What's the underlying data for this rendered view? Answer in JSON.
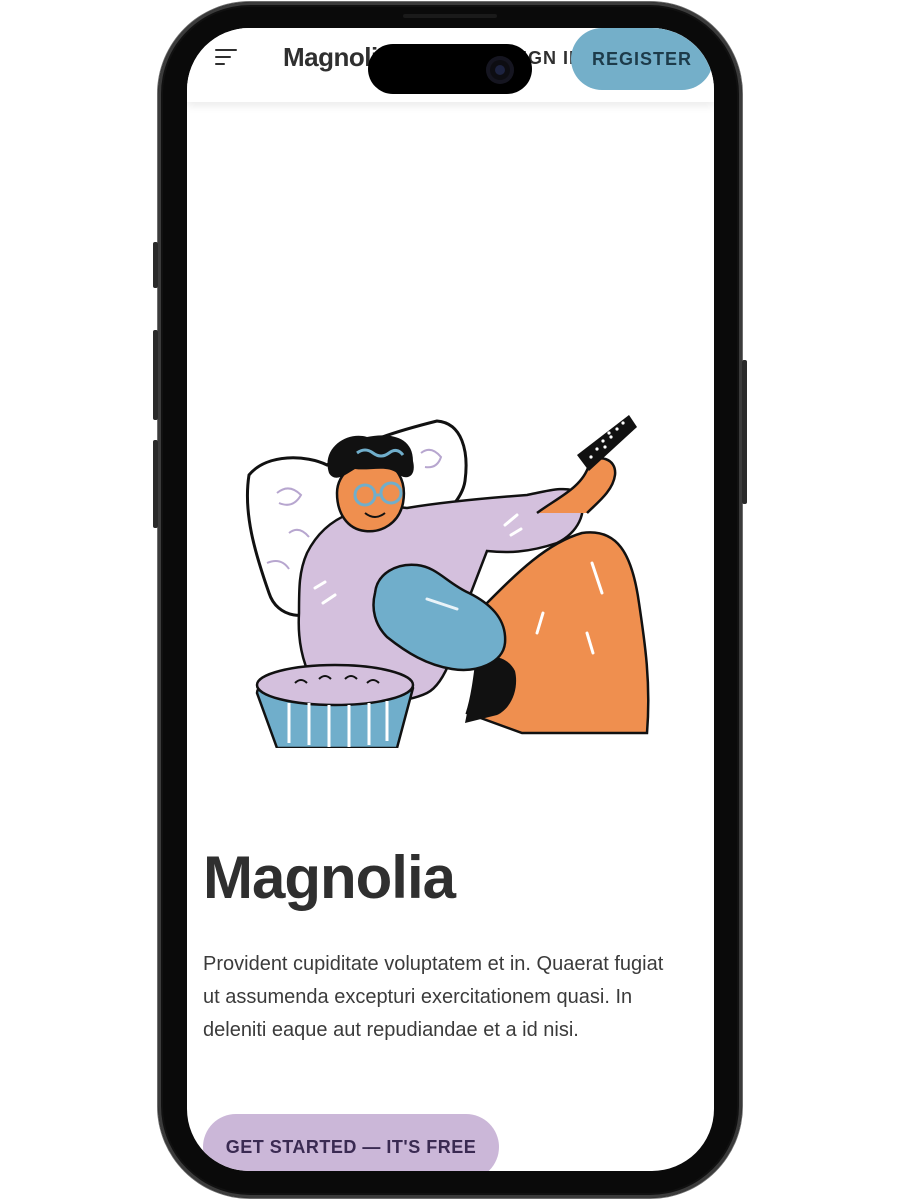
{
  "header": {
    "brand": "Magnolia",
    "signin_label": "SIGN IN",
    "register_label": "REGISTER",
    "menu_icon": "hamburger-menu-icon"
  },
  "hero": {
    "illustration": "person-on-couch-with-remote-and-popcorn",
    "title": "Magnolia",
    "text": "Provident cupiditate voluptatem et in. Quaerat fugiat ut assumenda excepturi exercitationem quasi. In deleniti eaque aut repudiandae et a id nisi.",
    "cta_label": "GET STARTED — IT'S FREE"
  },
  "colors": {
    "register_bg": "#74afc9",
    "cta_bg": "#cbb7d8",
    "text": "#2f2f2f",
    "skin": "#ef8f4f",
    "sweater": "#d4c0dd",
    "blue": "#70aecb"
  }
}
